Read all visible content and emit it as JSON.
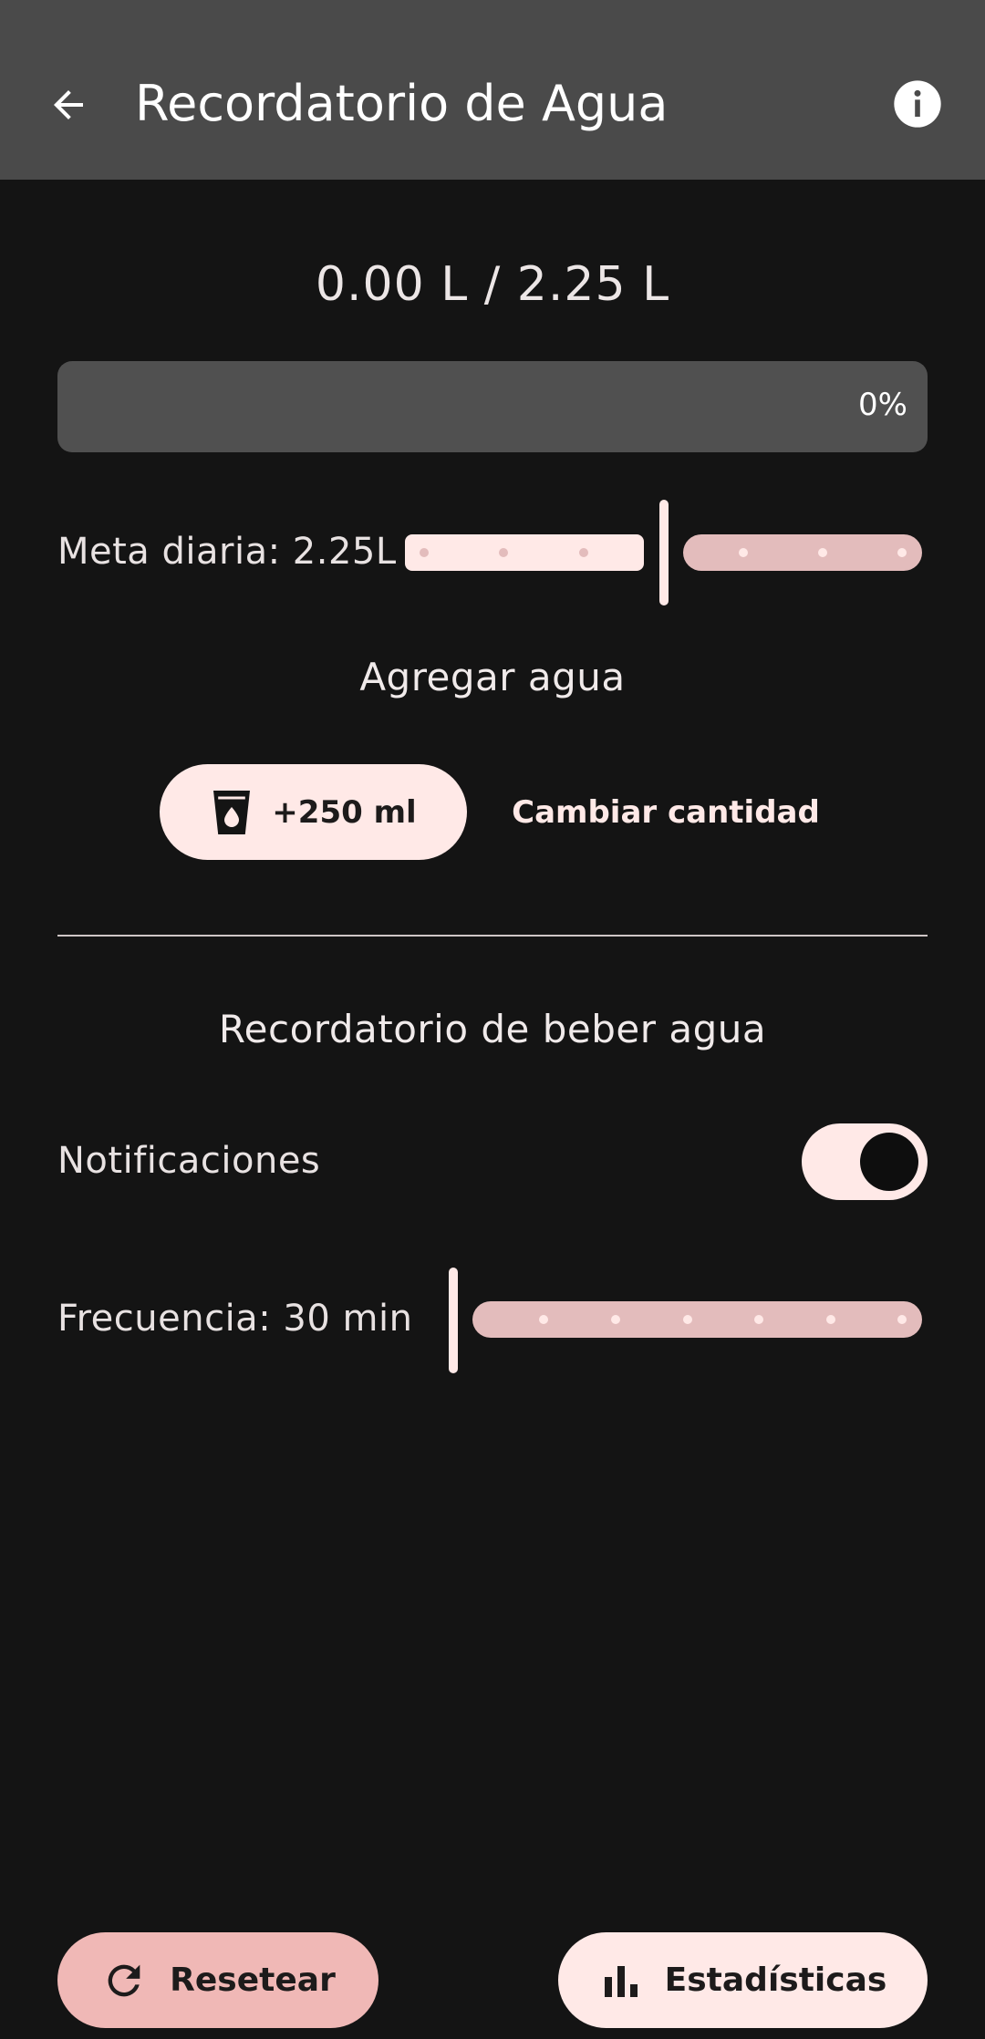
{
  "appbar": {
    "title": "Recordatorio de Agua",
    "back_icon": "arrow-back-icon",
    "info_icon": "info-icon"
  },
  "progress": {
    "current_text": "0.00 L / 2.25 L",
    "percent_label": "0%",
    "fraction": 0
  },
  "goal": {
    "label": "Meta diaria: 2.25L",
    "value_fraction": 0.5
  },
  "add_water": {
    "title": "Agregar agua",
    "add_button_label": "+250 ml",
    "add_button_icon": "water-glass-icon",
    "change_amount_label": "Cambiar cantidad"
  },
  "reminder": {
    "title": "Recordatorio de beber agua",
    "notifications_label": "Notificaciones",
    "notifications_on": true,
    "frequency_label": "Frecuencia: 30 min",
    "frequency_fraction": 0
  },
  "bottom": {
    "reset_label": "Resetear",
    "reset_icon": "refresh-icon",
    "stats_label": "Estadísticas",
    "stats_icon": "bar-chart-icon"
  },
  "colors": {
    "background": "#141414",
    "appbar": "#4a4a4a",
    "accent_light": "#ffe9e7",
    "accent_muted": "#e3bcbc",
    "reset_button": "#f0b8b6"
  }
}
